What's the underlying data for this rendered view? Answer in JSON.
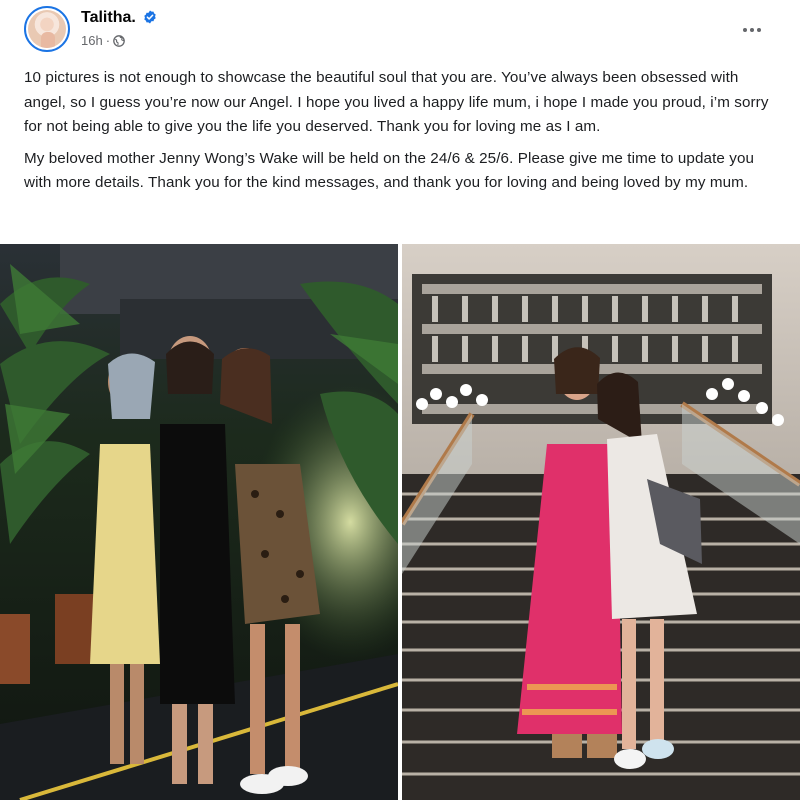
{
  "post": {
    "author": "Talitha.",
    "timestamp": "16h",
    "separator": "·",
    "paragraphs": [
      "10 pictures is not enough to showcase the beautiful soul that you are. You’ve always been obsessed with angel, so I guess you’re now our Angel. I hope you lived a happy life mum, i hope I made you proud, i’m sorry for not being able to give you the life you deserved. Thank you for loving me as I am.",
      "My beloved mother Jenny Wong’s Wake will be held on the 24/6 & 25/6. Please give me time to update you with more details. Thank you for the kind messages, and thank you for loving and being loved by my mum."
    ]
  },
  "icons": {
    "verified": "verified-badge-icon",
    "audience": "globe-icon",
    "more": "more-options-icon"
  },
  "colors": {
    "verified_blue": "#1b74e4",
    "meta_gray": "#65676b",
    "text": "#1c1e21"
  }
}
